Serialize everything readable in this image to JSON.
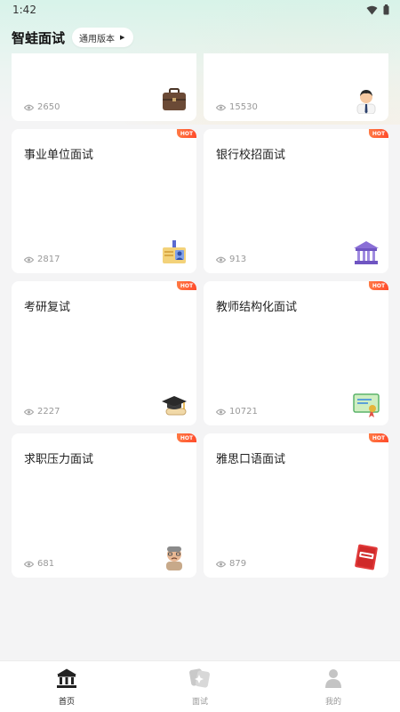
{
  "status": {
    "time": "1:42"
  },
  "header": {
    "title": "智蛙面试",
    "version_label": "通用版本"
  },
  "cards": [
    {
      "title": "",
      "views": "2650",
      "hot": false,
      "icon": "briefcase-icon"
    },
    {
      "title": "",
      "views": "15530",
      "hot": false,
      "icon": "businessman-icon"
    },
    {
      "title": "事业单位面试",
      "views": "2817",
      "hot": true,
      "hot_label": "HOT",
      "icon": "id-badge-icon"
    },
    {
      "title": "银行校招面试",
      "views": "913",
      "hot": true,
      "hot_label": "HOT",
      "icon": "bank-icon"
    },
    {
      "title": "考研复试",
      "views": "2227",
      "hot": true,
      "hot_label": "HOT",
      "icon": "graduation-cap-icon"
    },
    {
      "title": "教师结构化面试",
      "views": "10721",
      "hot": true,
      "hot_label": "HOT",
      "icon": "certificate-icon"
    },
    {
      "title": "求职压力面试",
      "views": "681",
      "hot": true,
      "hot_label": "HOT",
      "icon": "stressed-man-icon"
    },
    {
      "title": "雅思口语面试",
      "views": "879",
      "hot": true,
      "hot_label": "HOT",
      "icon": "ielts-book-icon"
    }
  ],
  "tabbar": [
    {
      "label": "首页",
      "icon": "home-bank-icon",
      "active": true
    },
    {
      "label": "面试",
      "icon": "interview-cards-icon",
      "active": false
    },
    {
      "label": "我的",
      "icon": "profile-icon",
      "active": false
    }
  ]
}
